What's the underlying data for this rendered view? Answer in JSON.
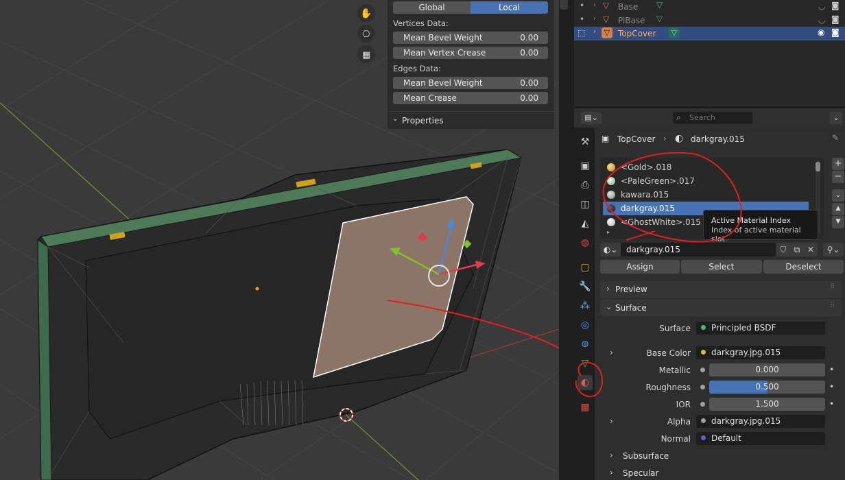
{
  "npanel": {
    "transform_modes": [
      "Global",
      "Local"
    ],
    "vertices_heading": "Vertices Data:",
    "vert_fields": [
      {
        "label": "Mean Bevel Weight",
        "value": "0.00"
      },
      {
        "label": "Mean Vertex Crease",
        "value": "0.00"
      }
    ],
    "edges_heading": "Edges Data:",
    "edge_fields": [
      {
        "label": "Mean Bevel Weight",
        "value": "0.00"
      },
      {
        "label": "Mean Crease",
        "value": "0.00"
      }
    ],
    "properties_panel": "Properties"
  },
  "outliner": {
    "rows": [
      {
        "name": "Base"
      },
      {
        "name": "PiBase"
      },
      {
        "name": "TopCover"
      }
    ]
  },
  "properties": {
    "search_placeholder": "Search",
    "breadcrumb": {
      "object": "TopCover",
      "material": "darkgray.015"
    },
    "slots": [
      "<Gold>.018",
      "<PaleGreen>.017",
      "kawara.015",
      "darkgray.015",
      "<GhostWhite>.015"
    ],
    "tooltip": {
      "title": "Active Material Index",
      "desc": "Index of active material slot."
    },
    "material_name": "darkgray.015",
    "assign": "Assign",
    "select": "Select",
    "deselect": "Deselect",
    "preview": "Preview",
    "surface_panel": "Surface",
    "surface": {
      "label": "Surface",
      "value": "Principled BSDF"
    },
    "base_color": {
      "label": "Base Color",
      "value": "darkgray.jpg.015"
    },
    "metallic": {
      "label": "Metallic",
      "value": "0.000"
    },
    "roughness": {
      "label": "Roughness",
      "value": "0.500",
      "fraction": 0.5
    },
    "ior": {
      "label": "IOR",
      "value": "1.500"
    },
    "alpha": {
      "label": "Alpha",
      "value": "darkgray.jpg.015"
    },
    "normal": {
      "label": "Normal",
      "value": "Default"
    },
    "subsurface": "Subsurface",
    "specular": "Specular"
  },
  "colors": {
    "accent": "#4772b3",
    "annotation": "#e0201f",
    "selected_face": "#8c7566"
  }
}
